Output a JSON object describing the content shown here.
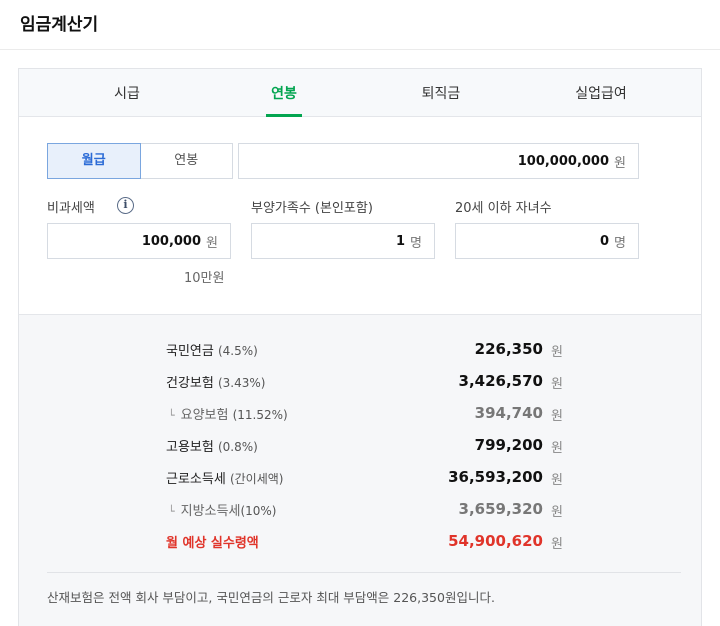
{
  "header": {
    "title": "임금계산기"
  },
  "tabs": [
    {
      "label": "시급",
      "active": false
    },
    {
      "label": "연봉",
      "active": true
    },
    {
      "label": "퇴직금",
      "active": false
    },
    {
      "label": "실업급여",
      "active": false
    }
  ],
  "pay_type": {
    "monthly_label": "월급",
    "annual_label": "연봉",
    "selected": "월급"
  },
  "salary": {
    "value": "100,000,000",
    "unit": "원"
  },
  "nontaxable": {
    "label": "비과세액",
    "value": "100,000",
    "unit": "원",
    "hint": "10만원"
  },
  "dependents": {
    "label": "부양가족수 (본인포함)",
    "value": "1",
    "unit": "명"
  },
  "children": {
    "label": "20세 이하 자녀수",
    "value": "0",
    "unit": "명"
  },
  "results": {
    "unit": "원",
    "rows": [
      {
        "name": "국민연금",
        "pct": "(4.5%)",
        "value": "226,350"
      },
      {
        "name": "건강보험",
        "pct": "(3.43%)",
        "value": "3,426,570"
      },
      {
        "name": "요양보험",
        "pct": "(11.52%)",
        "value": "394,740",
        "sub": true
      },
      {
        "name": "고용보험",
        "pct": "(0.8%)",
        "value": "799,200"
      },
      {
        "name": "근로소득세",
        "pct": "(간이세액)",
        "value": "36,593,200"
      },
      {
        "name": "지방소득세",
        "pct": "(10%)",
        "value": "3,659,320",
        "sub": true
      },
      {
        "name": "월 예상 실수령액",
        "pct": "",
        "value": "54,900,620",
        "total": true
      }
    ]
  },
  "note": "산재보험은 전액 회사 부담이고, 국민연금의 근로자 최대 부담액은 226,350원입니다.",
  "colors": {
    "accent_green": "#03a550",
    "total_red": "#e0342a",
    "selected_blue": "#2b6bd6"
  }
}
